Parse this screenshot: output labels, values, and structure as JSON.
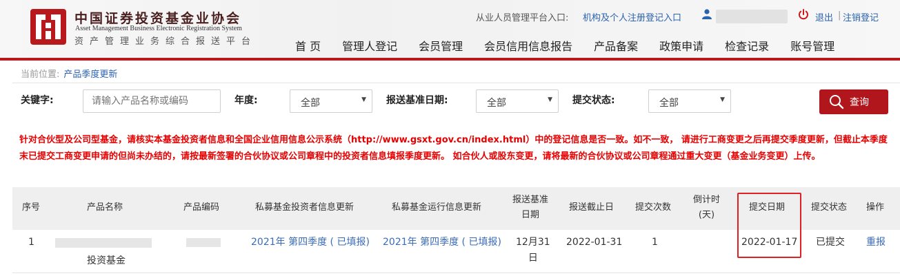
{
  "header": {
    "logo_cn": "中国证券投资基金业协会",
    "logo_en": "Asset Management Business Electronic Registration System",
    "logo_sub": "资产管理业务综合报送平台",
    "platform_label": "从业人员管理平台入口:",
    "platform_link": "机构及个人注册登记入口",
    "logout": "退出",
    "separator": "|",
    "cancel_account": "注销登记",
    "brand_color": "#b7191c"
  },
  "nav": {
    "items": [
      "首 页",
      "管理人登记",
      "会员管理",
      "会员信用信息报告",
      "产品备案",
      "政策申请",
      "检查记录",
      "账号管理"
    ]
  },
  "breadcrumb": {
    "label": "当前位置:",
    "current": "产品季度更新"
  },
  "filters": {
    "keyword_label": "关键字:",
    "keyword_placeholder": "请输入产品名称或编码",
    "year_label": "年度:",
    "year_value": "全部",
    "report_date_label": "报送基准日期:",
    "report_date_value": "全部",
    "status_label": "提交状态:",
    "status_value": "全部",
    "query_button": "查询"
  },
  "notice": "针对合伙型及公司型基金，请核实本基金投资者信息和全国企业信用信息公示系统（http://www.gsxt.gov.cn/index.html）中的登记信息是否一致。如不一致， 请进行工商变更之后再提交季度更新，但截止本季度末已提交工商变更申请的但尚未办结的，请按最新签署的合伙协议或公司章程中的投资者信息填报季度更新。 如合伙人或股东变更，请将最新的合伙协议或公司章程通过重大变更（基金业务变更）上传。",
  "table": {
    "headers": {
      "no": "序号",
      "name": "产品名称",
      "code": "产品编码",
      "investor_update": "私募基金投资者信息更新",
      "operation_update": "私募基金运行信息更新",
      "report_date_l1": "报送基准",
      "report_date_l2": "日期",
      "deadline": "报送截止日",
      "submit_count": "提交次数",
      "countdown_l1": "倒计时",
      "countdown_l2": "(天)",
      "submit_date": "提交日期",
      "submit_status": "提交状态",
      "action": "操作"
    },
    "rows": [
      {
        "no": "1",
        "name_tail": "投资基金",
        "investor_update": "2021年 第四季度 ( 已填报)",
        "operation_update": "2021年 第四季度 ( 已填报)",
        "report_date_l1": "12月31",
        "report_date_l2": "日",
        "deadline": "2022-01-31",
        "submit_count": "1",
        "countdown": "",
        "submit_date": "2022-01-17",
        "submit_status": "已提交",
        "action": "重报"
      }
    ]
  }
}
